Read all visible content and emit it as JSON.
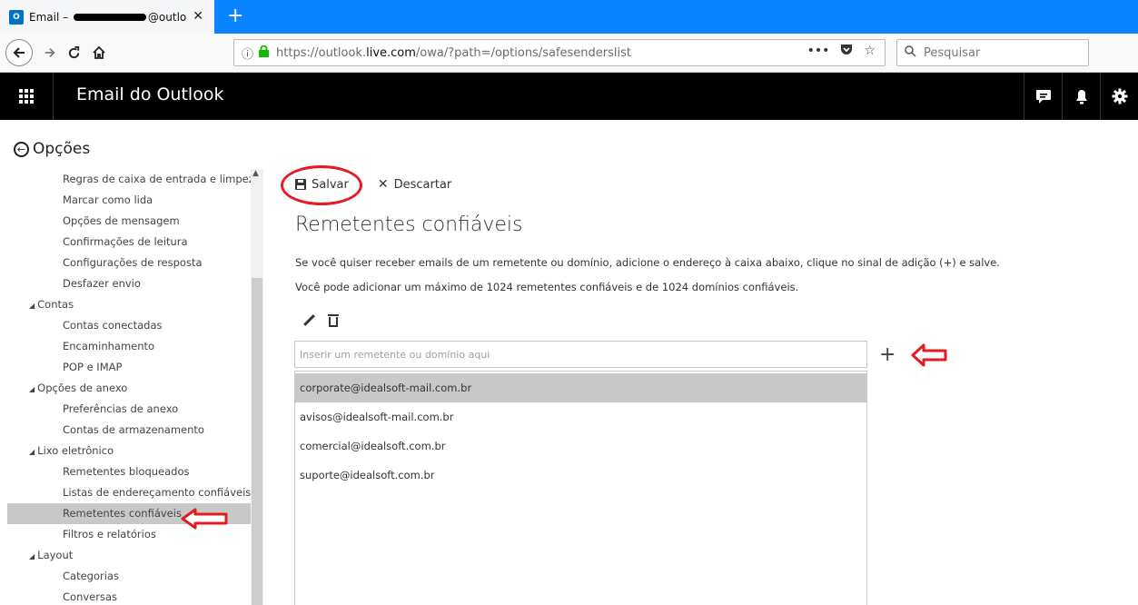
{
  "browser": {
    "tab": {
      "favicon": "O",
      "title_prefix": "Email – ",
      "title_suffix": "@outlook.c",
      "close_glyph": "✕"
    },
    "new_tab_glyph": "+",
    "url": {
      "prefix": "https://outlook.",
      "domain": "live.com",
      "path": "/owa/?path=/options/safesenderslist"
    },
    "url_actions": [
      "•••",
      "◘",
      "☆"
    ],
    "search_placeholder": "Pesquisar"
  },
  "app": {
    "title": "Email do Outlook",
    "header_icons": [
      "chat-icon",
      "bell-icon",
      "gear-icon"
    ]
  },
  "options": {
    "heading": "Opções"
  },
  "leftnav": {
    "items": [
      {
        "label": "Regras de caixa de entrada e limpeza",
        "kind": "child"
      },
      {
        "label": "Marcar como lida",
        "kind": "child"
      },
      {
        "label": "Opções de mensagem",
        "kind": "child"
      },
      {
        "label": "Confirmações de leitura",
        "kind": "child"
      },
      {
        "label": "Configurações de resposta",
        "kind": "child"
      },
      {
        "label": "Desfazer envio",
        "kind": "child"
      },
      {
        "label": "Contas",
        "kind": "group"
      },
      {
        "label": "Contas conectadas",
        "kind": "child"
      },
      {
        "label": "Encaminhamento",
        "kind": "child"
      },
      {
        "label": "POP e IMAP",
        "kind": "child"
      },
      {
        "label": "Opções de anexo",
        "kind": "group"
      },
      {
        "label": "Preferências de anexo",
        "kind": "child"
      },
      {
        "label": "Contas de armazenamento",
        "kind": "child"
      },
      {
        "label": "Lixo eletrônico",
        "kind": "group"
      },
      {
        "label": "Remetentes bloqueados",
        "kind": "child"
      },
      {
        "label": "Listas de endereçamento confiáveis",
        "kind": "child"
      },
      {
        "label": "Remetentes confiáveis",
        "kind": "child",
        "selected": true
      },
      {
        "label": "Filtros e relatórios",
        "kind": "child"
      },
      {
        "label": "Layout",
        "kind": "group"
      },
      {
        "label": "Categorias",
        "kind": "child"
      },
      {
        "label": "Conversas",
        "kind": "child"
      }
    ]
  },
  "main": {
    "save_label": "Salvar",
    "discard_label": "Descartar",
    "title": "Remetentes confiáveis",
    "desc1": "Se você quiser receber emails de um remetente ou domínio, adicione o endereço à caixa abaixo, clique no sinal de adição (+) e salve.",
    "desc2": "Você pode adicionar um máximo de 1024 remetentes confiáveis e de 1024 domínios confiáveis.",
    "input_placeholder": "Inserir um remetente ou domínio aqui",
    "add_glyph": "+",
    "senders": [
      {
        "email": "corporate@idealsoft-mail.com.br",
        "selected": true
      },
      {
        "email": "avisos@idealsoft-mail.com.br"
      },
      {
        "email": "comercial@idealsoft.com.br"
      },
      {
        "email": "suporte@idealsoft.com.br"
      }
    ]
  },
  "colors": {
    "tabstrip": "#0a84ff",
    "appbar": "#000000",
    "selection": "#c8c8c8",
    "annotation_red": "#e31b23"
  }
}
